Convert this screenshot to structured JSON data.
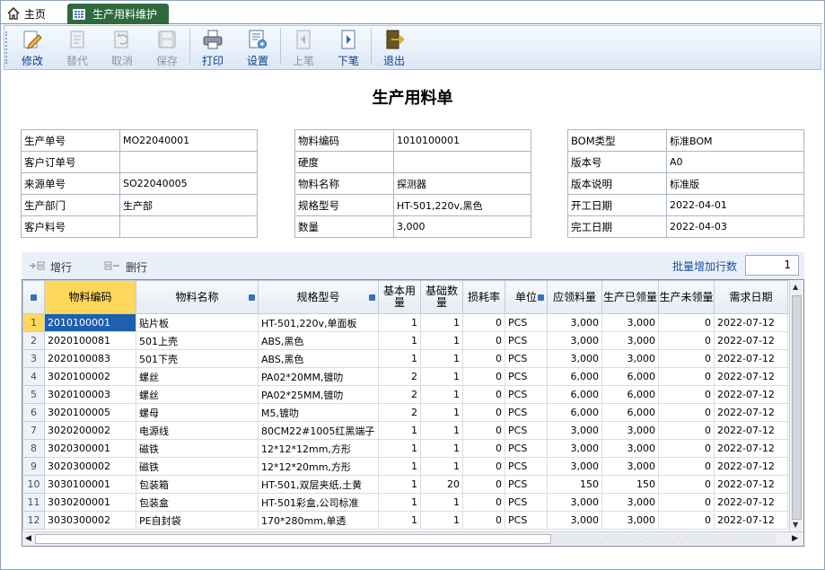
{
  "tabs": {
    "home": "主页",
    "active": "生产用料维护"
  },
  "toolbar": [
    {
      "label": "修改",
      "icon": "edit-icon",
      "enabled": true
    },
    {
      "label": "替代",
      "icon": "replace-icon",
      "enabled": false
    },
    {
      "label": "取消",
      "icon": "cancel-icon",
      "enabled": false
    },
    {
      "label": "保存",
      "icon": "save-icon",
      "enabled": false
    },
    {
      "label": "打印",
      "icon": "print-icon",
      "enabled": true
    },
    {
      "label": "设置",
      "icon": "settings-icon",
      "enabled": true
    },
    {
      "label": "上笔",
      "icon": "prev-record-icon",
      "enabled": false
    },
    {
      "label": "下笔",
      "icon": "next-record-icon",
      "enabled": true
    },
    {
      "label": "退出",
      "icon": "exit-icon",
      "enabled": true
    }
  ],
  "title": "生产用料单",
  "info_left": [
    {
      "label": "生产单号",
      "value": "MO22040001"
    },
    {
      "label": "客户订单号",
      "value": ""
    },
    {
      "label": "来源单号",
      "value": "SO22040005"
    },
    {
      "label": "生产部门",
      "value": "生产部"
    },
    {
      "label": "客户料号",
      "value": ""
    }
  ],
  "info_mid": [
    {
      "label": "物料编码",
      "value": "1010100001"
    },
    {
      "label": "硬度",
      "value": ""
    },
    {
      "label": "物料名称",
      "value": "探测器"
    },
    {
      "label": "规格型号",
      "value": "HT-501,220v,黑色"
    },
    {
      "label": "数量",
      "value": "3,000"
    }
  ],
  "info_right": [
    {
      "label": "BOM类型",
      "value": "标准BOM"
    },
    {
      "label": "版本号",
      "value": "A0"
    },
    {
      "label": "版本说明",
      "value": "标准版"
    },
    {
      "label": "开工日期",
      "value": "2022-04-01"
    },
    {
      "label": "完工日期",
      "value": "2022-04-03"
    }
  ],
  "gridbar": {
    "add_row": "增行",
    "delete_row": "删行",
    "batch_label": "批量增加行数",
    "batch_value": "1"
  },
  "columns": [
    "物料编码",
    "物料名称",
    "规格型号",
    "基本用量",
    "基础数量",
    "损耗率",
    "单位",
    "应领料量",
    "生产已领量",
    "生产未领量",
    "需求日期"
  ],
  "rows": [
    [
      "1",
      "2010100001",
      "贴片板",
      "HT-501,220v,单面板",
      "1",
      "1",
      "0",
      "PCS",
      "3,000",
      "3,000",
      "0",
      "2022-07-12"
    ],
    [
      "2",
      "2020100081",
      "501上壳",
      "ABS,黑色",
      "1",
      "1",
      "0",
      "PCS",
      "3,000",
      "3,000",
      "0",
      "2022-07-12"
    ],
    [
      "3",
      "2020100083",
      "501下壳",
      "ABS,黑色",
      "1",
      "1",
      "0",
      "PCS",
      "3,000",
      "3,000",
      "0",
      "2022-07-12"
    ],
    [
      "4",
      "3020100002",
      "螺丝",
      "PA02*20MM,镀叻",
      "2",
      "1",
      "0",
      "PCS",
      "6,000",
      "6,000",
      "0",
      "2022-07-12"
    ],
    [
      "5",
      "3020100003",
      "螺丝",
      "PA02*25MM,镀叻",
      "2",
      "1",
      "0",
      "PCS",
      "6,000",
      "6,000",
      "0",
      "2022-07-12"
    ],
    [
      "6",
      "3020100005",
      "螺母",
      "M5,镀叻",
      "2",
      "1",
      "0",
      "PCS",
      "6,000",
      "6,000",
      "0",
      "2022-07-12"
    ],
    [
      "7",
      "3020200002",
      "电源线",
      "80CM22#1005红黑端子",
      "1",
      "1",
      "0",
      "PCS",
      "3,000",
      "3,000",
      "0",
      "2022-07-12"
    ],
    [
      "8",
      "3020300001",
      "磁铁",
      "12*12*12mm,方形",
      "1",
      "1",
      "0",
      "PCS",
      "3,000",
      "3,000",
      "0",
      "2022-07-12"
    ],
    [
      "9",
      "3020300002",
      "磁铁",
      "12*12*20mm,方形",
      "1",
      "1",
      "0",
      "PCS",
      "3,000",
      "3,000",
      "0",
      "2022-07-12"
    ],
    [
      "10",
      "3030100001",
      "包装箱",
      "HT-501,双层夹纸,土黄",
      "1",
      "20",
      "0",
      "PCS",
      "150",
      "150",
      "0",
      "2022-07-12"
    ],
    [
      "11",
      "3030200001",
      "包装盒",
      "HT-501彩盒,公司标准",
      "1",
      "1",
      "0",
      "PCS",
      "3,000",
      "3,000",
      "0",
      "2022-07-12"
    ],
    [
      "12",
      "3030300002",
      "PE自封袋",
      "170*280mm,单透",
      "1",
      "1",
      "0",
      "PCS",
      "3,000",
      "3,000",
      "0",
      "2022-07-12"
    ]
  ]
}
